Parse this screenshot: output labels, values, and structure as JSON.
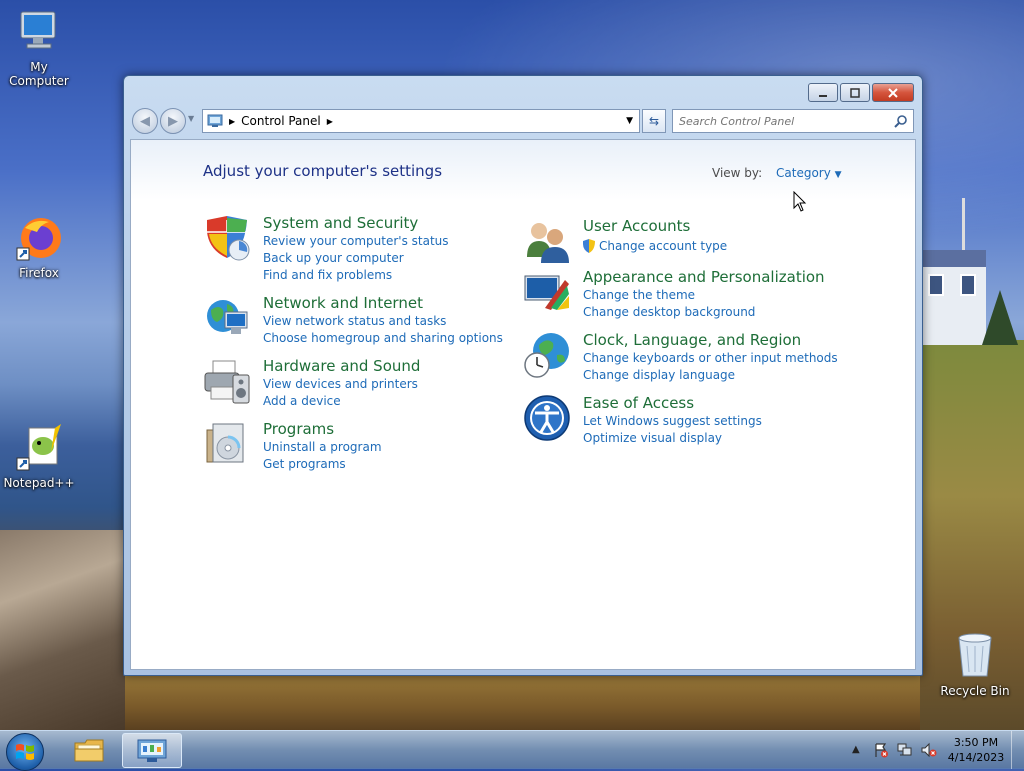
{
  "desktop": {
    "icons": [
      {
        "label": "My Computer"
      },
      {
        "label": "Firefox"
      },
      {
        "label": "Notepad++"
      },
      {
        "label": "Recycle Bin"
      }
    ]
  },
  "window": {
    "breadcrumb": "Control Panel",
    "search_placeholder": "Search Control Panel",
    "heading": "Adjust your computer's settings",
    "view_by_label": "View by:",
    "view_by_value": "Category",
    "categories": [
      {
        "title": "System and Security",
        "links": [
          "Review your computer's status",
          "Back up your computer",
          "Find and fix problems"
        ]
      },
      {
        "title": "Network and Internet",
        "links": [
          "View network status and tasks",
          "Choose homegroup and sharing options"
        ]
      },
      {
        "title": "Hardware and Sound",
        "links": [
          "View devices and printers",
          "Add a device"
        ]
      },
      {
        "title": "Programs",
        "links": [
          "Uninstall a program",
          "Get programs"
        ]
      },
      {
        "title": "User Accounts",
        "links": [
          "Change account type"
        ]
      },
      {
        "title": "Appearance and Personalization",
        "links": [
          "Change the theme",
          "Change desktop background"
        ]
      },
      {
        "title": "Clock, Language, and Region",
        "links": [
          "Change keyboards or other input methods",
          "Change display language"
        ]
      },
      {
        "title": "Ease of Access",
        "links": [
          "Let Windows suggest settings",
          "Optimize visual display"
        ]
      }
    ]
  },
  "taskbar": {
    "time": "3:50 PM",
    "date": "4/14/2023"
  },
  "colors": {
    "category_title": "#1e6e38",
    "link": "#1e6bb8",
    "heading": "#1e3287"
  }
}
